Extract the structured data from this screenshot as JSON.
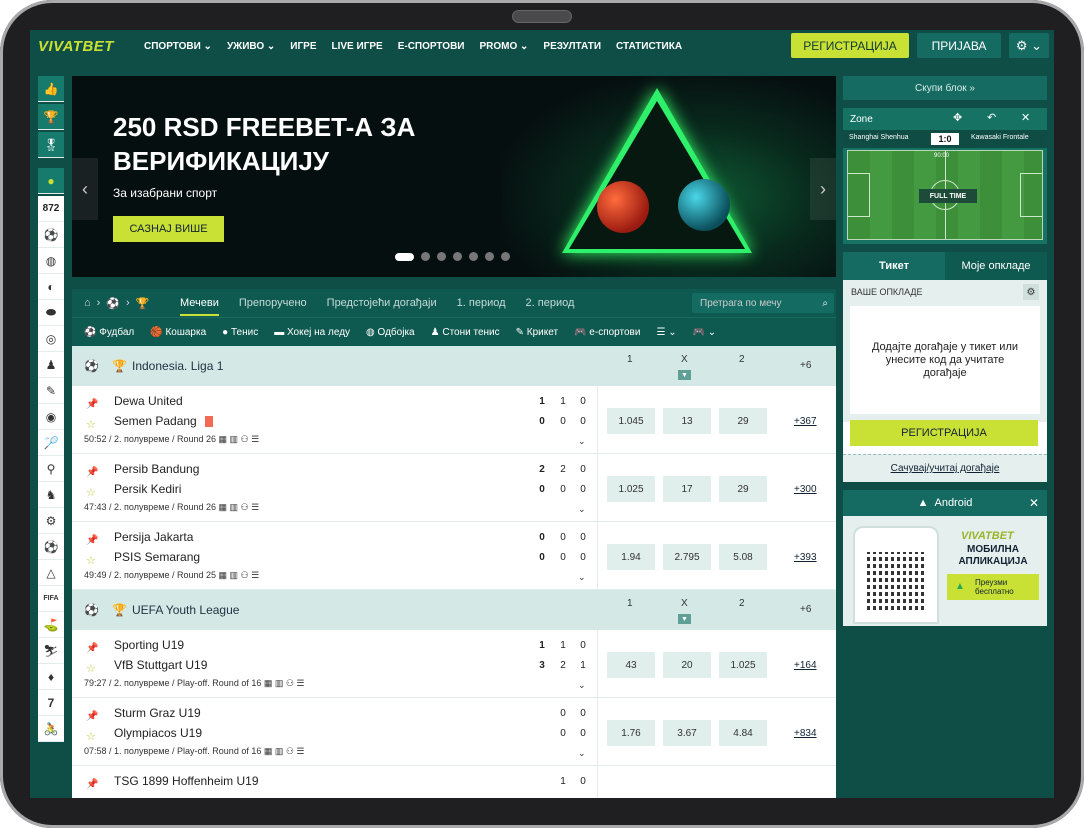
{
  "header": {
    "logo": "VIVATBET",
    "nav": [
      "СПОРТОВИ ⌄",
      "УЖИВО ⌄",
      "ИГРЕ",
      "LIVE ИГРЕ",
      "Е-СПОРТОВИ",
      "PROMO ⌄",
      "РЕЗУЛТАТИ",
      "СТАТИСТИКА"
    ],
    "register": "РЕГИСТРАЦИЈА",
    "login": "ПРИЈАВА",
    "settings_icon": "⚙ ⌄"
  },
  "sidebar": {
    "count": "872"
  },
  "banner": {
    "title": "250 RSD FREEBET-А ЗА ВЕРИФИКАЦИЈУ",
    "subtitle": "За изабрани спорт",
    "button": "САЗНАЈ ВИШЕ",
    "prev": "‹",
    "next": "›"
  },
  "tabs": {
    "items": [
      "Мечеви",
      "Препоручено",
      "Предстојећи догађаји",
      "1. период",
      "2. период"
    ],
    "search_placeholder": "Претрага по мечу"
  },
  "sports": [
    "⚽ Фудбал",
    "🏀 Кошарка",
    "● Тенис",
    "▬ Хокеј на леду",
    "◍ Одбојка",
    "♟ Стони тенис",
    "✎ Крикет",
    "🎮 е-спортови",
    "☰ ⌄",
    "🎮 ⌄"
  ],
  "leagues": [
    {
      "name": "Indonesia. Liga 1",
      "h1": "1",
      "hx": "X",
      "h2": "2",
      "more": "+6",
      "matches": [
        {
          "t1": "Dewa United",
          "t2": "Semen Padang",
          "s1": [
            "1",
            "1",
            "0"
          ],
          "s2": [
            "0",
            "0",
            "0"
          ],
          "info": "50:52 / 2. полувреме / Round 26",
          "o1": "1.045",
          "ox": "13",
          "o2": "29",
          "plus": "+367"
        },
        {
          "t1": "Persib Bandung",
          "t2": "Persik Kediri",
          "s1": [
            "2",
            "2",
            "0"
          ],
          "s2": [
            "0",
            "0",
            "0"
          ],
          "info": "47:43 / 2. полувреме / Round 26",
          "o1": "1.025",
          "ox": "17",
          "o2": "29",
          "plus": "+300"
        },
        {
          "t1": "Persija Jakarta",
          "t2": "PSIS Semarang",
          "s1": [
            "0",
            "0",
            "0"
          ],
          "s2": [
            "0",
            "0",
            "0"
          ],
          "info": "49:49 / 2. полувреме / Round 25",
          "o1": "1.94",
          "ox": "2.795",
          "o2": "5.08",
          "plus": "+393"
        }
      ]
    },
    {
      "name": "UEFA Youth League",
      "h1": "1",
      "hx": "X",
      "h2": "2",
      "more": "+6",
      "matches": [
        {
          "t1": "Sporting U19",
          "t2": "VfB Stuttgart U19",
          "s1": [
            "1",
            "1",
            "0"
          ],
          "s2": [
            "3",
            "2",
            "1"
          ],
          "info": "79:27 / 2. полувреме / Play-off. Round of 16",
          "o1": "43",
          "ox": "20",
          "o2": "1.025",
          "plus": "+164"
        },
        {
          "t1": "Sturm Graz U19",
          "t2": "Olympiacos U19",
          "s1": [
            "",
            "0",
            "0"
          ],
          "s2": [
            "",
            "0",
            "0"
          ],
          "info": "07:58 / 1. полувреме / Play-off. Round of 16",
          "o1": "1.76",
          "ox": "3.67",
          "o2": "4.84",
          "plus": "+834"
        },
        {
          "t1": "TSG 1899 Hoffenheim U19",
          "t2": "",
          "s1": [
            "",
            "1",
            "0"
          ],
          "s2": [
            "",
            "",
            ""
          ],
          "info": "",
          "o1": "",
          "ox": "",
          "o2": "",
          "plus": ""
        }
      ]
    }
  ],
  "right": {
    "collapse": "Скупи блок »",
    "zone": {
      "title": "Zone",
      "home": "Shanghai Shenhua",
      "away": "Kawasaki Frontale",
      "score": "1:0",
      "time": "90:00",
      "status": "FULL TIME"
    },
    "ticket": {
      "tab1": "Тикет",
      "tab2": "Моје опкладе",
      "your_bets": "ВАШЕ ОПКЛАДЕ",
      "message": "Додајте догађаје у тикет или унесите код да учитате догађаје",
      "register": "РЕГИСТРАЦИЈА",
      "save": "Сачувај/учитај догађаје"
    },
    "android": {
      "title": "Android",
      "logo": "VIVATBET",
      "text": "МОБИЛНА АПЛИКАЦИЈА",
      "button": "Преузми бесплатно"
    }
  }
}
